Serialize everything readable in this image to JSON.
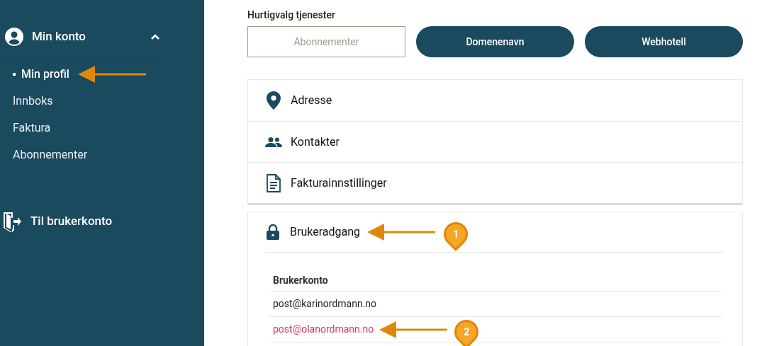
{
  "sidebar": {
    "account": {
      "label": "Min konto",
      "expanded": true
    },
    "items": [
      {
        "label": "Min profil",
        "selected": true,
        "callout": true
      },
      {
        "label": "Innboks",
        "selected": false,
        "callout": false
      },
      {
        "label": "Faktura",
        "selected": false,
        "callout": false
      },
      {
        "label": "Abonnementer",
        "selected": false,
        "callout": false
      }
    ],
    "exit_link": "Til brukerkonto"
  },
  "quick_services": {
    "title": "Hurtigvalg tjenester",
    "buttons": [
      {
        "label": "Abonnementer",
        "kind": "outline"
      },
      {
        "label": "Domenenavn",
        "kind": "filled"
      },
      {
        "label": "Webhotell",
        "kind": "filled"
      }
    ]
  },
  "sections": [
    {
      "kind": "pin",
      "label": "Adresse"
    },
    {
      "kind": "people",
      "label": "Kontakter"
    },
    {
      "kind": "document",
      "label": "Fakturainnstillinger"
    }
  ],
  "access": {
    "label": "Brukeradgang",
    "callout": "1",
    "table_header": "Brukerkonto",
    "rows": [
      {
        "email": "post@karinordmann.no",
        "highlighted": false,
        "callout": ""
      },
      {
        "email": "post@olanordmann.no",
        "highlighted": true,
        "callout": "2"
      }
    ]
  }
}
